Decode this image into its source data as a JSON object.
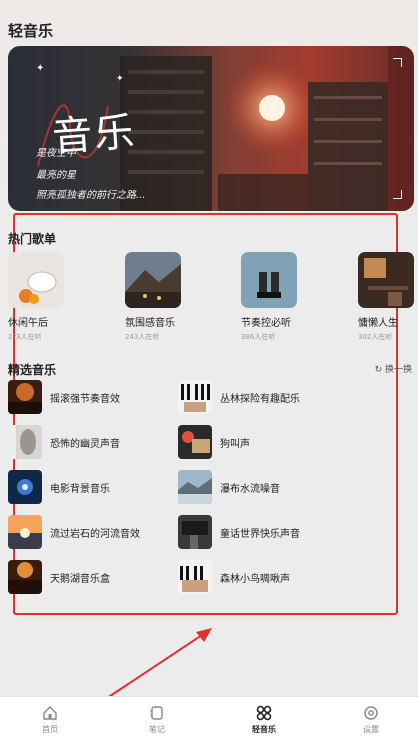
{
  "app_title": "轻音乐",
  "banner": {
    "title": "音乐",
    "lines": [
      "是夜空中",
      "最亮的星",
      "照亮孤独者的前行之路..."
    ]
  },
  "hot_playlists": {
    "title": "热门歌单",
    "items": [
      {
        "name": "休闲午后",
        "count": "2?3人在听"
      },
      {
        "name": "氛围感音乐",
        "count": "243人在听"
      },
      {
        "name": "节奏控必听",
        "count": "386人在听"
      },
      {
        "name": "慵懒人生",
        "count": "302人在听"
      }
    ]
  },
  "featured": {
    "title": "精选音乐",
    "refresh_label": "换一换",
    "tracks": [
      "摇滚强节奏音效",
      "丛林探险有趣配乐",
      "恐怖的幽灵声音",
      "狗叫声",
      "电影背景音乐",
      "瀑布水流噪音",
      "流过岩石的河流音效",
      "童话世界快乐声音",
      "天鹅湖音乐盒",
      "森林小鸟啁啾声"
    ]
  },
  "tabbar": {
    "items": [
      "首页",
      "笔记",
      "轻音乐",
      "设置"
    ],
    "active": "轻音乐"
  },
  "colors": {
    "highlight": "#e3302b",
    "accent": "#e3452a"
  }
}
